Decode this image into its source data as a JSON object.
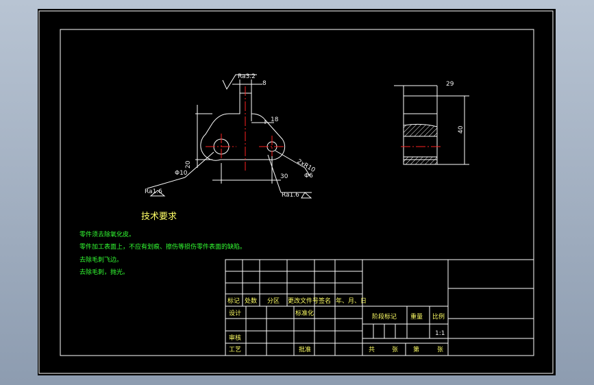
{
  "drawing": {
    "front_view": {
      "roughness_top": "Ra3.2",
      "dim_top_width": "8",
      "dim_slot": "18",
      "dim_height": "20",
      "dim_center_distance": "30",
      "dim_hole_left": "Φ10",
      "dim_hole_right": "Φ6",
      "dim_chamfer": "2xR10",
      "roughness_left": "Ra1.6",
      "roughness_right": "Ra1.6"
    },
    "side_view": {
      "dim_width": "29",
      "dim_height": "40"
    }
  },
  "tech_requirements": {
    "title": "技术要求",
    "lines": [
      "零件须去除氧化皮。",
      "零件加工表面上，不应有划痕、擦伤等损伤零件表面的缺陷。",
      "去除毛刺飞边。",
      "去除毛刺，抛光。"
    ]
  },
  "title_block": {
    "rev_headers": [
      "标记",
      "处数",
      "分区",
      "更改文件号",
      "签名",
      "年、月、日"
    ],
    "design": "设计",
    "standardize": "标准化",
    "review": "审核",
    "process": "工艺",
    "approve": "批准",
    "stage_mark": "阶段标记",
    "weight": "重量",
    "scale": "比例",
    "scale_value": "1:1",
    "total": "共",
    "sheets": "张",
    "number": "第",
    "sheet": "张"
  },
  "colors": {
    "background": "#000000",
    "outline": "#ffffff",
    "dimension": "#ffffff",
    "centerline": "#ff2020",
    "text_requirements": "#33ff33",
    "text_block": "#ffff66"
  }
}
